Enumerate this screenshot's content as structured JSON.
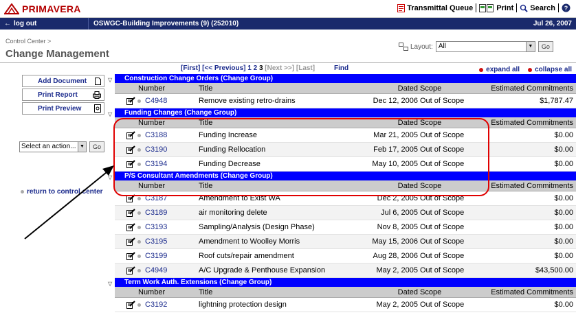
{
  "header": {
    "logo_text": "PRIMAVERA",
    "actions": [
      {
        "label": "Transmittal Queue",
        "icon": "document-icon"
      },
      {
        "label": "Print",
        "icon": "print-icon"
      },
      {
        "label": "Search",
        "icon": "search-icon"
      },
      {
        "label": "",
        "icon": "help-icon"
      }
    ]
  },
  "navbar": {
    "logout": "log out",
    "project": "OSWGC-Building Improvements (9) (252010)",
    "date": "Jul 26, 2007"
  },
  "page": {
    "breadcrumb": "Control Center >",
    "title": "Change Management",
    "layout_label": "Layout:",
    "layout_value": "All",
    "go": "Go"
  },
  "left": {
    "buttons": [
      "Add Document",
      "Print Report",
      "Print Preview"
    ],
    "action_select": "Select an action...",
    "action_go": "Go",
    "return_link": "return to control center"
  },
  "pager": {
    "first": "[First]",
    "prev": "[<< Previous]",
    "pages": [
      "1",
      "2",
      "3"
    ],
    "next": "[Next >>]",
    "last": "[Last]",
    "find": "Find"
  },
  "expcol": {
    "expand": "expand all",
    "collapse": "collapse all"
  },
  "columns": {
    "number": "Number",
    "title": "Title",
    "dated": "Dated",
    "scope": "Scope",
    "est": "Estimated Commitments"
  },
  "groups": [
    {
      "title": "Construction Change Orders (Change Group)",
      "rows": [
        {
          "number": "C4948",
          "title": "Remove existing retro-drains",
          "dated": "Dec 12, 2006",
          "scope": "Out of Scope",
          "est": "$1,787.47"
        }
      ]
    },
    {
      "title": "Funding Changes (Change Group)",
      "rows": [
        {
          "number": "C3188",
          "title": "Funding Increase",
          "dated": "Mar 21, 2005",
          "scope": "Out of Scope",
          "est": "$0.00"
        },
        {
          "number": "C3190",
          "title": "Funding Rellocation",
          "dated": "Feb 17, 2005",
          "scope": "Out of Scope",
          "est": "$0.00"
        },
        {
          "number": "C3194",
          "title": "Funding Decrease",
          "dated": "May 10, 2005",
          "scope": "Out of Scope",
          "est": "$0.00"
        }
      ]
    },
    {
      "title": "P/S Consultant Amendments (Change Group)",
      "rows": [
        {
          "number": "C3187",
          "title": "Amendment to Exist WA",
          "dated": "Dec 2, 2005",
          "scope": "Out of Scope",
          "est": "$0.00"
        },
        {
          "number": "C3189",
          "title": "air monitoring delete",
          "dated": "Jul 6, 2005",
          "scope": "Out of Scope",
          "est": "$0.00"
        },
        {
          "number": "C3193",
          "title": "Sampling/Analysis (Design Phase)",
          "dated": "Nov 8, 2005",
          "scope": "Out of Scope",
          "est": "$0.00"
        },
        {
          "number": "C3195",
          "title": "Amendment to Woolley Morris",
          "dated": "May 15, 2006",
          "scope": "Out of Scope",
          "est": "$0.00"
        },
        {
          "number": "C3199",
          "title": "Roof cuts/repair amendment",
          "dated": "Aug 28, 2006",
          "scope": "Out of Scope",
          "est": "$0.00"
        },
        {
          "number": "C4949",
          "title": "A/C Upgrade & Penthouse Expansion",
          "dated": "May 2, 2005",
          "scope": "Out of Scope",
          "est": "$43,500.00"
        }
      ]
    },
    {
      "title": "Term Work Auth. Extensions (Change Group)",
      "rows": [
        {
          "number": "C3192",
          "title": "lightning protection design",
          "dated": "May 2, 2005",
          "scope": "Out of Scope",
          "est": "$0.00"
        }
      ]
    }
  ]
}
